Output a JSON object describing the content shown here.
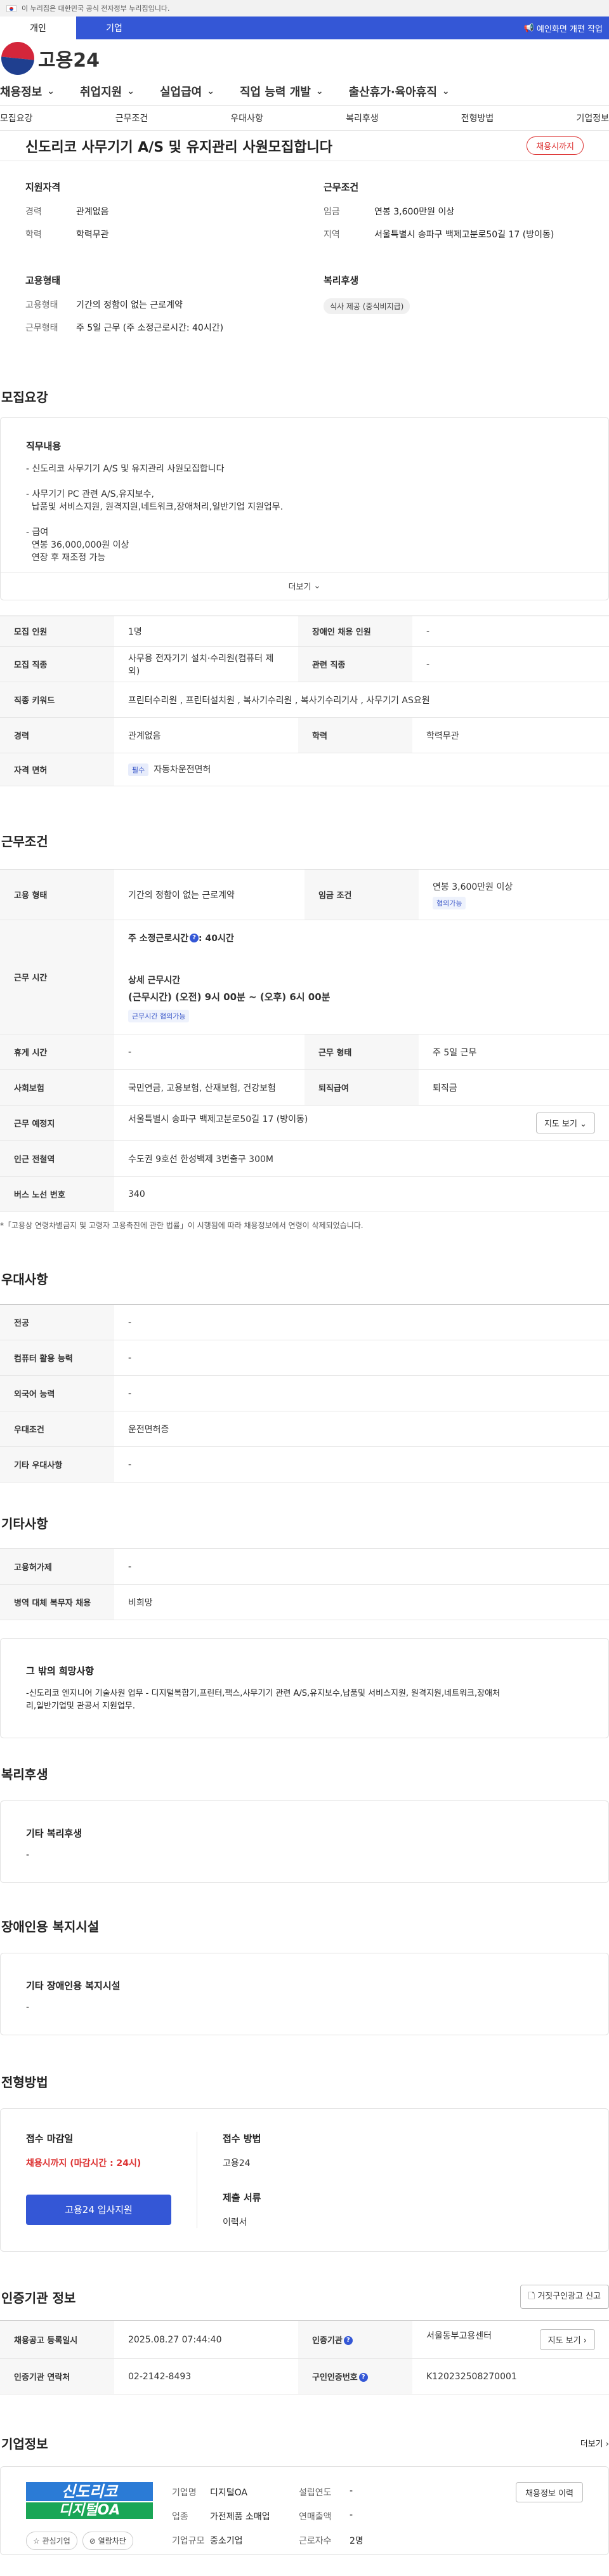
{
  "gov_banner": "이 누리집은 대한민국 공식 전자정부 누리집입니다.",
  "topbar": {
    "tab_person": "개인",
    "tab_company": "기업",
    "notice": "예인화면 개편 작업"
  },
  "logo": {
    "text": "고용24"
  },
  "gnb": [
    "채용정보",
    "취업지원",
    "실업급여",
    "직업 능력 개발",
    "출산휴가·육아휴직"
  ],
  "subnav": [
    "모집요강",
    "근무조건",
    "우대사항",
    "복리후생",
    "전형방법",
    "기업정보"
  ],
  "title": "신도리코 사무기기 A/S 및 유지관리 사원모집합니다",
  "deadline_badge": "채용시까지",
  "summary": {
    "qualification": {
      "head": "지원자격",
      "career_k": "경력",
      "career_v": "관계없음",
      "edu_k": "학력",
      "edu_v": "학력무관"
    },
    "condition": {
      "head": "근무조건",
      "wage_k": "임금",
      "wage_v": "연봉 3,600만원 이상",
      "area_k": "지역",
      "area_v": "서울특별시 송파구 백제고분로50길 17 (방이동)"
    },
    "employment": {
      "head": "고용형태",
      "type_k": "고용형태",
      "type_v": "기간의 정함이 없는 근로계약",
      "hours_k": "근무형태",
      "hours_v": "주 5일 근무 (주 소정근로시간: 40시간)"
    },
    "welfare": {
      "head": "복리후생",
      "chip": "식사 제공 (중식비지급)"
    }
  },
  "recruit": {
    "section_title": "모집요강",
    "duty_head": "직무내용",
    "lines": [
      "- 신도리코 사무기기 A/S 및 유지관리 사원모집합니다",
      "",
      "- 사무기기 PC 관련 A/S,유지보수,",
      "  납품및 서비스지원, 원격지원,네트워크,장애처리,일반기업 지원업무.",
      "",
      "- 급여",
      "  연봉 36,000,000원 이상",
      "  연장 후 재조정 가능"
    ],
    "more": "더보기"
  },
  "recruit_table": {
    "count_k": "모집 인원",
    "count_v": "1명",
    "disabled_k": "장애인 채용 인원",
    "disabled_v": "-",
    "job_k": "모집 직종",
    "job_v": "사무용 전자기기 설치·수리원(컴퓨터 제외)",
    "rel_k": "관련 직종",
    "rel_v": "-",
    "kw_k": "직종 키워드",
    "kw_v": "프린터수리원 , 프린터설치원 , 복사기수리원 , 복사기수리기사 , 사무기기 AS요원",
    "career_k": "경력",
    "career_v": "관계없음",
    "edu_k": "학력",
    "edu_v": "학력무관",
    "license_k": "자격 면허",
    "license_tag": "필수",
    "license_v": "자동차운전면허"
  },
  "work": {
    "section_title": "근무조건",
    "emp_k": "고용 형태",
    "emp_v": "기간의 정함이 없는 근로계약",
    "wage_k": "임금 조건",
    "wage_v": "연봉 3,600만원 이상",
    "wage_tag": "협의가능",
    "hours_k": "근무 시간",
    "hours_std_label": "주 소정근로시간",
    "hours_std_value": ": 40시간",
    "hours_detail_head": "상세 근무시간",
    "hours_detail": "(근무시간) (오전) 9시 00분 ~ (오후) 6시 00분",
    "hours_tag": "근무시간 협의가능",
    "rest_k": "휴게 시간",
    "rest_v": "-",
    "form_k": "근무 형태",
    "form_v": "주 5일 근무",
    "ins_k": "사회보험",
    "ins_v": "국민연금, 고용보험, 산재보험, 건강보험",
    "retire_k": "퇴직급여",
    "retire_v": "퇴직금",
    "place_k": "근무 예정지",
    "place_v": "서울특별시 송파구 백제고분로50길 17 (방이동)",
    "map_btn": "지도 보기",
    "subway_k": "인근 전철역",
    "subway_v": "수도권 9호선 한성백제 3번출구 300M",
    "bus_k": "버스 노선 번호",
    "bus_v": "340",
    "footnote": "*「고용상 연령차별금지 및 고령자 고용촉진에 관한 법률」이 시행됨에 따라 채용정보에서 연령이 삭제되었습니다."
  },
  "prefer": {
    "section_title": "우대사항",
    "major_k": "전공",
    "major_v": "-",
    "pc_k": "컴퓨터 활용 능력",
    "pc_v": "-",
    "lang_k": "외국어 능력",
    "lang_v": "-",
    "cond_k": "우대조건",
    "cond_v": "운전면허증",
    "etc_k": "기타 우대사항",
    "etc_v": "-"
  },
  "other": {
    "section_title": "기타사항",
    "date_k": "고용허가제",
    "date_v": "-",
    "mil_k": "병역 대체 복무자 채용",
    "mil_v": "비희망",
    "extra_head": "그 밖의 희망사항",
    "extra_line1": "-신도리코 엔지니어 기술사원 업무 - 디지털복합기,프린터,팩스,사무기기 관련 A/S,유지보수,납품및 서비스지원, 원격지원,네트워크,장애처",
    "extra_line2": "리,일반기업및 관공서 지원업무."
  },
  "benefit": {
    "section_title": "복리후생",
    "head": "기타 복리후생",
    "value": "-"
  },
  "disabled": {
    "section_title": "장애인용 복지시설",
    "head": "기타 장애인용 복지시설",
    "value": "-"
  },
  "process": {
    "section_title": "전형방법",
    "deadline_head": "접수 마감일",
    "deadline_value": "채용시까지 (마감시간 : 24시)",
    "apply_btn": "고용24 입사지원",
    "method_head": "접수 방법",
    "method_value": "고용24",
    "docs_head": "제출 서류",
    "docs_value": "이력서"
  },
  "cert": {
    "section_title": "인증기관 정보",
    "report_btn": "거짓구인광고 신고",
    "reg_k": "채용공고 등록일시",
    "reg_v": "2025.08.27 07:44:40",
    "agency_k": "인증기관",
    "agency_v": "서울동부고용센터",
    "map_btn": "지도 보기",
    "tel_k": "인증기관 연락처",
    "tel_v": "02-2142-8493",
    "no_k": "구인인증번호",
    "no_v": "K120232508270001"
  },
  "company": {
    "section_title": "기업정보",
    "more": "더보기",
    "logo_line1": "신도리코",
    "logo_line2": "디지털OA",
    "interest_btn": "관심기업",
    "block_btn": "열람차단",
    "name_k": "기업명",
    "name_v": "디지털OA",
    "found_k": "설립연도",
    "found_v": "-",
    "ind_k": "업종",
    "ind_v": "가전제품 소매업",
    "sales_k": "연매출액",
    "sales_v": "-",
    "size_k": "기업규모",
    "size_v": "중소기업",
    "emp_k": "근로자수",
    "emp_v": "2명",
    "info_btn": "채용정보 이력"
  }
}
